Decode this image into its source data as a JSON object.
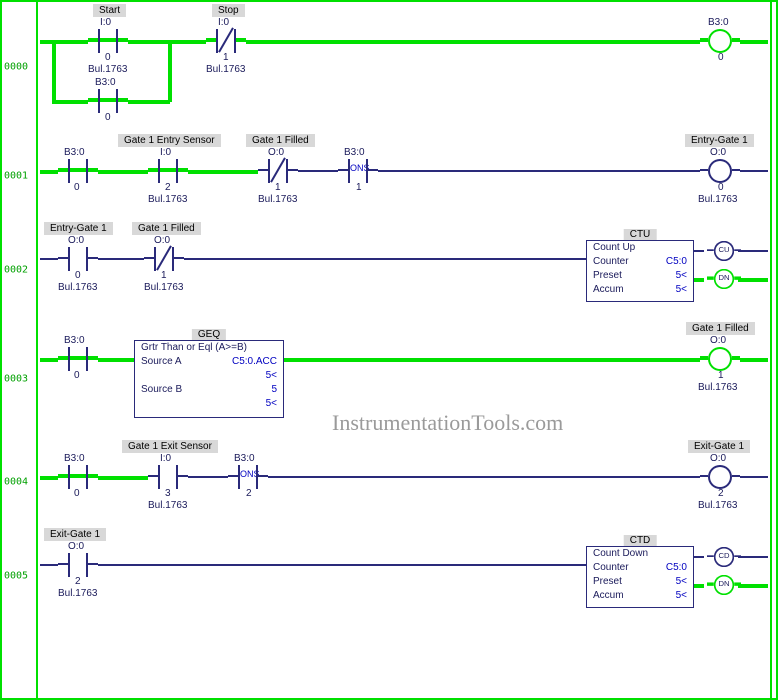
{
  "watermark": "InstrumentationTools.com",
  "rungs": [
    {
      "num": "0000",
      "start": {
        "label": "Start",
        "addr": "I:0",
        "bit": "0",
        "bul": "Bul.1763"
      },
      "stop": {
        "label": "Stop",
        "addr": "I:0",
        "bit": "1",
        "bul": "Bul.1763"
      },
      "latch": {
        "addr": "B3:0",
        "bit": "0"
      },
      "out": {
        "addr": "B3:0",
        "bit": "0"
      }
    },
    {
      "num": "0001",
      "en": {
        "addr": "B3:0",
        "bit": "0"
      },
      "sensor": {
        "label": "Gate 1 Entry Sensor",
        "addr": "I:0",
        "bit": "2",
        "bul": "Bul.1763"
      },
      "filled": {
        "label": "Gate 1 Filled",
        "addr": "O:0",
        "bit": "1",
        "bul": "Bul.1763"
      },
      "ons": {
        "addr": "B3:0",
        "bit": "1",
        "txt": "ONS"
      },
      "out": {
        "label": "Entry-Gate 1",
        "addr": "O:0",
        "bit": "0",
        "bul": "Bul.1763"
      }
    },
    {
      "num": "0002",
      "a": {
        "label": "Entry-Gate 1",
        "addr": "O:0",
        "bit": "0",
        "bul": "Bul.1763"
      },
      "b": {
        "label": "Gate 1 Filled",
        "addr": "O:0",
        "bit": "1",
        "bul": "Bul.1763"
      },
      "ctu": {
        "title": "CTU",
        "lines": [
          {
            "k": "Count Up",
            "v": ""
          },
          {
            "k": "Counter",
            "v": "C5:0"
          },
          {
            "k": "Preset",
            "v": "5<"
          },
          {
            "k": "Accum",
            "v": "5<"
          }
        ],
        "cu": "CU",
        "dn": "DN"
      }
    },
    {
      "num": "0003",
      "en": {
        "addr": "B3:0",
        "bit": "0"
      },
      "geq": {
        "title": "GEQ",
        "desc": "Grtr Than or Eql (A>=B)",
        "lines": [
          {
            "k": "Source A",
            "v": "C5:0.ACC"
          },
          {
            "k": "",
            "v": "5<"
          },
          {
            "k": "Source B",
            "v": "5"
          },
          {
            "k": "",
            "v": "5<"
          }
        ]
      },
      "out": {
        "label": "Gate 1 Filled",
        "addr": "O:0",
        "bit": "1",
        "bul": "Bul.1763"
      }
    },
    {
      "num": "0004",
      "en": {
        "addr": "B3:0",
        "bit": "0"
      },
      "sensor": {
        "label": "Gate 1 Exit Sensor",
        "addr": "I:0",
        "bit": "3",
        "bul": "Bul.1763"
      },
      "ons": {
        "addr": "B3:0",
        "bit": "2",
        "txt": "ONS"
      },
      "out": {
        "label": "Exit-Gate 1",
        "addr": "O:0",
        "bit": "2",
        "bul": "Bul.1763"
      }
    },
    {
      "num": "0005",
      "a": {
        "label": "Exit-Gate 1",
        "addr": "O:0",
        "bit": "2",
        "bul": "Bul.1763"
      },
      "ctd": {
        "title": "CTD",
        "lines": [
          {
            "k": "Count Down",
            "v": ""
          },
          {
            "k": "Counter",
            "v": "C5:0"
          },
          {
            "k": "Preset",
            "v": "5<"
          },
          {
            "k": "Accum",
            "v": "5<"
          }
        ],
        "cd": "CD",
        "dn": "DN"
      }
    }
  ]
}
